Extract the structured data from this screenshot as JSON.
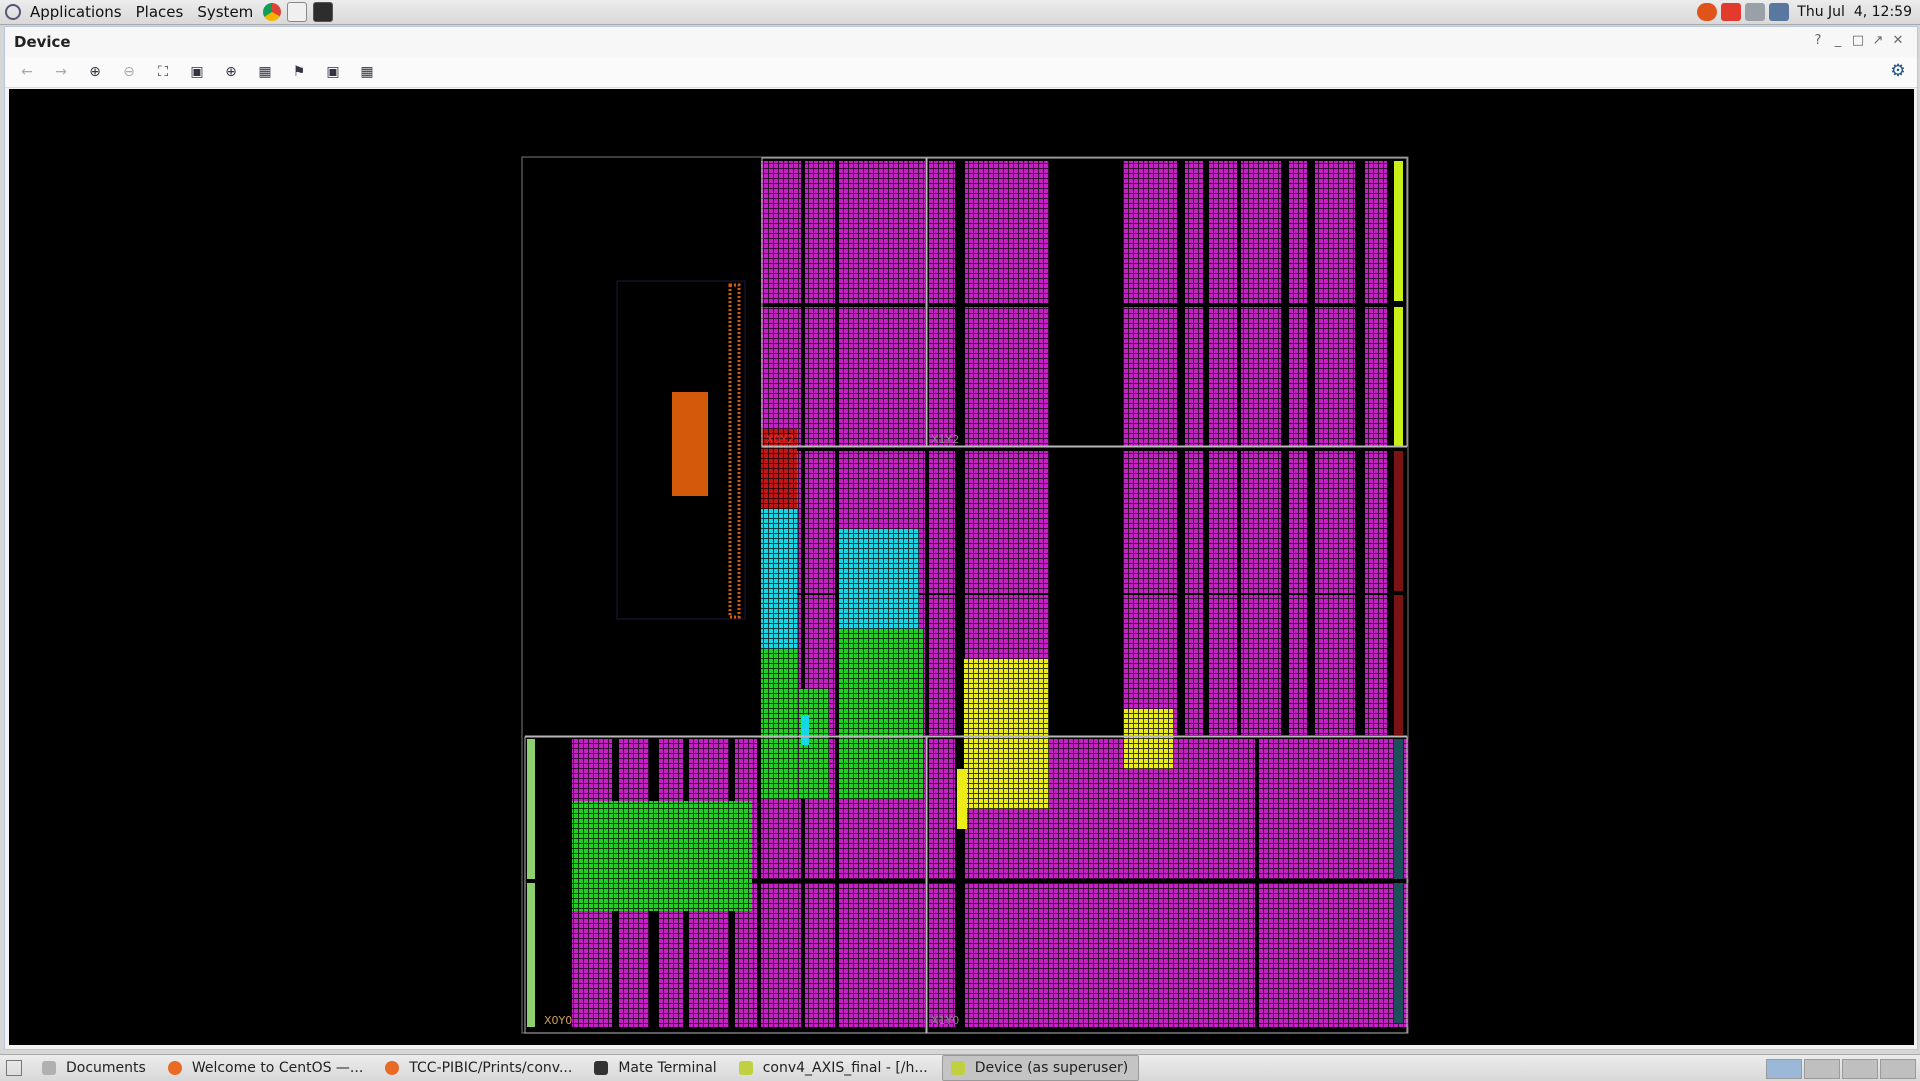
{
  "top_panel": {
    "menus": [
      "Applications",
      "Places",
      "System"
    ],
    "clock": "Thu Jul  4, 12:59"
  },
  "window": {
    "title": "Device",
    "controls": [
      "?",
      "_",
      "□",
      "↗",
      "✕"
    ]
  },
  "toolbar": {
    "buttons": [
      "back",
      "forward",
      "zoom-in",
      "zoom-out",
      "zoom-fit",
      "zoom-selected",
      "auto-fit-selection",
      "route-highlight",
      "place-ports",
      "show-cells",
      "expand"
    ]
  },
  "device": {
    "region_labels": [
      "X0Y2",
      "X1Y2",
      "X0Y0",
      "X1Y0"
    ]
  },
  "taskbar": {
    "items": [
      "Documents",
      "Welcome to CentOS —...",
      "TCC-PIBIC/Prints/conv...",
      "Mate Terminal",
      "conv4_AXIS_final - [/h...",
      "Device (as superuser)"
    ],
    "active_index": 5
  },
  "colors": {
    "fabric": "#c61fc6",
    "green": "#21d021",
    "cyan": "#17d6e6",
    "yellow": "#ecec18",
    "red": "#c21616",
    "orange": "#d35a0a",
    "lime_strip": "#c8f018",
    "teal_strip": "#1d4f5a",
    "maroon_strip": "#7a1414"
  }
}
